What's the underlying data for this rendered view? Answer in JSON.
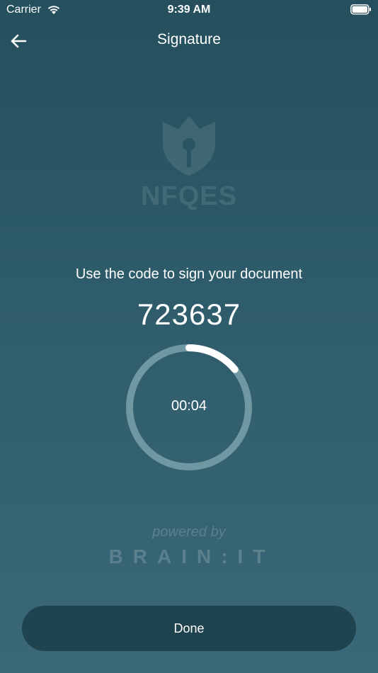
{
  "status_bar": {
    "carrier": "Carrier",
    "time": "9:39 AM",
    "wifi_icon": "wifi-icon",
    "battery_icon": "battery-icon"
  },
  "nav": {
    "title": "Signature",
    "back_icon": "arrow-left-icon"
  },
  "logo": {
    "text": "NFQES",
    "icon": "shield-pen-icon"
  },
  "main": {
    "prompt": "Use the code to sign your document",
    "code": "723637",
    "timer": {
      "text": "00:04",
      "progress": 0.14
    }
  },
  "footer": {
    "powered_by": "powered by",
    "brand": "BRAIN:IT"
  },
  "actions": {
    "done_label": "Done"
  },
  "colors": {
    "background_top": "#254f5d",
    "background_bottom": "#3a6878",
    "button": "#1f4450",
    "ring_track": "#6f98a2",
    "ring_progress": "#ffffff"
  }
}
